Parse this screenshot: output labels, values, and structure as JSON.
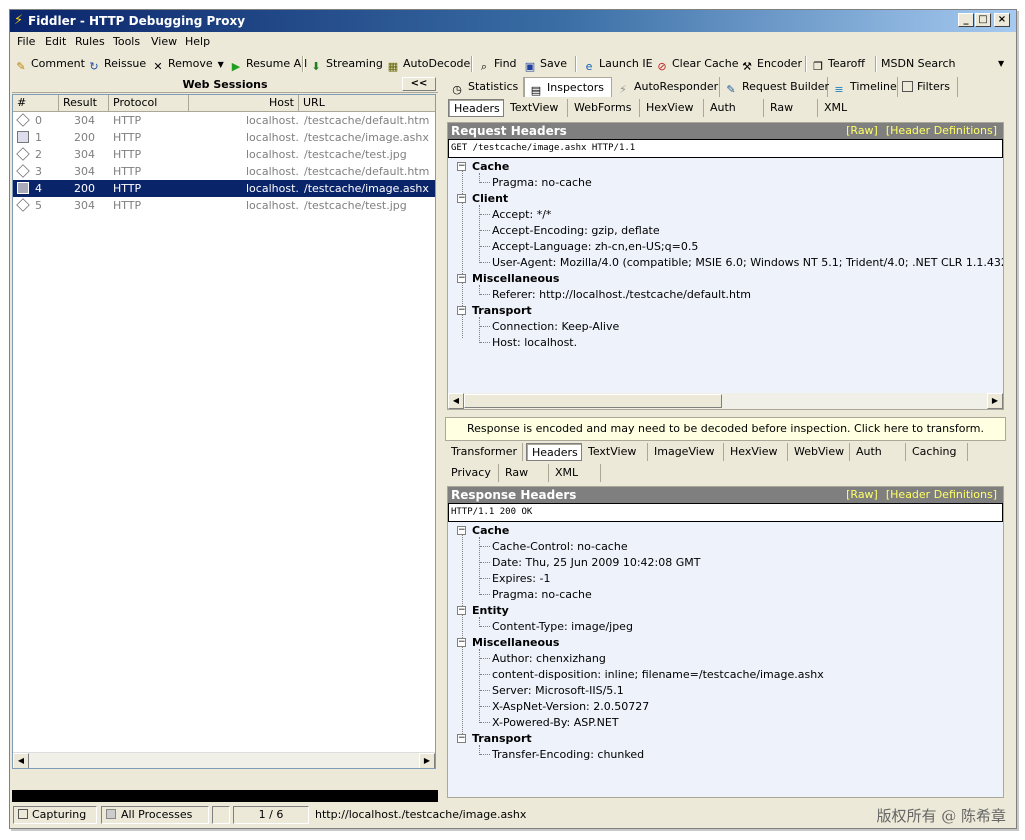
{
  "window": {
    "title": "Fiddler - HTTP Debugging Proxy",
    "min": "_",
    "max": "□",
    "close": "×"
  },
  "menu": [
    "File",
    "Edit",
    "Rules",
    "Tools",
    "View",
    "Help"
  ],
  "toolbar": {
    "comment": "Comment",
    "reissue": "Reissue",
    "remove": "Remove",
    "resume_all": "Resume All",
    "streaming": "Streaming",
    "autodecode": "AutoDecode",
    "find": "Find",
    "save": "Save",
    "launch_ie": "Launch IE",
    "clear_cache": "Clear Cache",
    "encoder": "Encoder",
    "tearoff": "Tearoff",
    "msdn_search": "MSDN Search"
  },
  "sessions": {
    "heading": "Web Sessions",
    "collapse": "<<",
    "columns": [
      "#",
      "Result",
      "Protocol",
      "Host",
      "URL"
    ],
    "rows": [
      {
        "num": "0",
        "result": "304",
        "protocol": "HTTP",
        "host": "localhost.",
        "url": "/testcache/default.htm"
      },
      {
        "num": "1",
        "result": "200",
        "protocol": "HTTP",
        "host": "localhost.",
        "url": "/testcache/image.ashx"
      },
      {
        "num": "2",
        "result": "304",
        "protocol": "HTTP",
        "host": "localhost.",
        "url": "/testcache/test.jpg"
      },
      {
        "num": "3",
        "result": "304",
        "protocol": "HTTP",
        "host": "localhost.",
        "url": "/testcache/default.htm"
      },
      {
        "num": "4",
        "result": "200",
        "protocol": "HTTP",
        "host": "localhost.",
        "url": "/testcache/image.ashx"
      },
      {
        "num": "5",
        "result": "304",
        "protocol": "HTTP",
        "host": "localhost.",
        "url": "/testcache/test.jpg"
      }
    ],
    "selected_index": 4
  },
  "tabs": {
    "main": [
      "Statistics",
      "Inspectors",
      "AutoResponder",
      "Request Builder",
      "Timeline",
      "Filters"
    ],
    "request": [
      "Headers",
      "TextView",
      "WebForms",
      "HexView",
      "Auth",
      "Raw",
      "XML"
    ],
    "response_row1": [
      "Transformer",
      "Headers",
      "TextView",
      "ImageView",
      "HexView",
      "WebView",
      "Auth",
      "Caching"
    ],
    "response_row2": [
      "Privacy",
      "Raw",
      "XML"
    ]
  },
  "request": {
    "title": "Request Headers",
    "raw_link": "[Raw]",
    "defs_link": "[Header Definitions]",
    "line": "GET /testcache/image.ashx HTTP/1.1",
    "groups": [
      {
        "name": "Cache",
        "headers": [
          "Pragma: no-cache"
        ]
      },
      {
        "name": "Client",
        "headers": [
          "Accept: */*",
          "Accept-Encoding: gzip, deflate",
          "Accept-Language: zh-cn,en-US;q=0.5",
          "User-Agent: Mozilla/4.0 (compatible; MSIE 6.0; Windows NT 5.1; Trident/4.0; .NET CLR 1.1.4322; .NET CL"
        ]
      },
      {
        "name": "Miscellaneous",
        "headers": [
          "Referer: http://localhost./testcache/default.htm"
        ]
      },
      {
        "name": "Transport",
        "headers": [
          "Connection: Keep-Alive",
          "Host: localhost."
        ]
      }
    ]
  },
  "notice": "Response is encoded and may need to be decoded before inspection.  Click here to transform.",
  "response": {
    "title": "Response Headers",
    "raw_link": "[Raw]",
    "defs_link": "[Header Definitions]",
    "line": "HTTP/1.1 200 OK",
    "groups": [
      {
        "name": "Cache",
        "headers": [
          "Cache-Control: no-cache",
          "Date: Thu, 25 Jun 2009 10:42:08 GMT",
          "Expires: -1",
          "Pragma: no-cache"
        ]
      },
      {
        "name": "Entity",
        "headers": [
          "Content-Type: image/jpeg"
        ]
      },
      {
        "name": "Miscellaneous",
        "headers": [
          "Author: chenxizhang",
          "content-disposition: inline; filename=/testcache/image.ashx",
          "Server: Microsoft-IIS/5.1",
          "X-AspNet-Version: 2.0.50727",
          "X-Powered-By: ASP.NET"
        ]
      },
      {
        "name": "Transport",
        "headers": [
          "Transfer-Encoding: chunked"
        ]
      }
    ]
  },
  "status": {
    "capturing": "Capturing",
    "processes": "All Processes",
    "count": "1 / 6",
    "url": "http://localhost./testcache/image.ashx",
    "watermark": "版权所有 @ 陈希章"
  }
}
